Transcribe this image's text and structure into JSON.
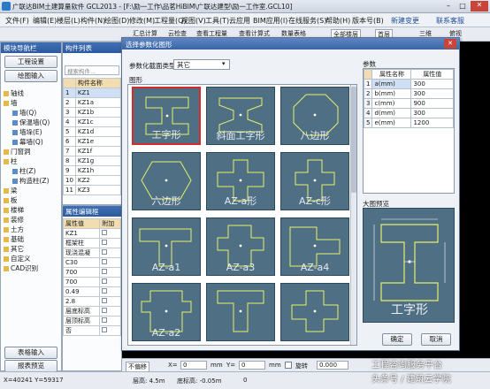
{
  "window": {
    "title": "广联达BIM土建算量软件 GCL2013 - [F:\\励一工作\\品茗HiBIM\\广联达建型\\励一工作室.GCL10]"
  },
  "menu": [
    "文件(F)",
    "编辑(E)",
    "楼层(L)",
    "构件(N)",
    "绘图(D)",
    "修改(M)",
    "工程量(Q)",
    "视图(V)",
    "工具(T)",
    "云应用",
    "BIM应用(I)",
    "在线服务(S)",
    "帮助(H)",
    "版本号(B)",
    "新建变更",
    "联系客服"
  ],
  "toolbar": {
    "items": [
      "汇总计算",
      "云检查",
      "查看工程量",
      "查看计算式",
      "数量表格",
      "全部楼层",
      "首层",
      "三维",
      "俯视"
    ]
  },
  "nav": {
    "title": "模块导航栏",
    "buttons": [
      "工程设置",
      "绘图输入"
    ],
    "tree": [
      {
        "label": "轴线",
        "indent": 0
      },
      {
        "label": "墙",
        "indent": 0
      },
      {
        "label": "墙(Q)",
        "indent": 1
      },
      {
        "label": "保温墙(Q)",
        "indent": 1
      },
      {
        "label": "墙垛(E)",
        "indent": 1
      },
      {
        "label": "幕墙(Q)",
        "indent": 1
      },
      {
        "label": "门窗洞",
        "indent": 0
      },
      {
        "label": "柱",
        "indent": 0
      },
      {
        "label": "柱(Z)",
        "indent": 1
      },
      {
        "label": "构造柱(Z)",
        "indent": 1
      },
      {
        "label": "梁",
        "indent": 0
      },
      {
        "label": "板",
        "indent": 0
      },
      {
        "label": "楼梯",
        "indent": 0
      },
      {
        "label": "装修",
        "indent": 0
      },
      {
        "label": "土方",
        "indent": 0
      },
      {
        "label": "基础",
        "indent": 0
      },
      {
        "label": "其它",
        "indent": 0
      },
      {
        "label": "自定义",
        "indent": 0
      },
      {
        "label": "CAD识别",
        "indent": 0
      }
    ],
    "bottom_buttons": [
      "表格输入",
      "报表预览"
    ]
  },
  "component_list": {
    "title": "构件列表",
    "search_placeholder": "搜索构件...",
    "header": "构件名称",
    "rows": [
      [
        "1",
        "KZ1"
      ],
      [
        "2",
        "KZ1a"
      ],
      [
        "3",
        "KZ1b"
      ],
      [
        "4",
        "KZ1c"
      ],
      [
        "5",
        "KZ1d"
      ],
      [
        "6",
        "KZ1e"
      ],
      [
        "7",
        "KZ1f"
      ],
      [
        "8",
        "KZ1g"
      ],
      [
        "9",
        "KZ1h"
      ],
      [
        "10",
        "KZ2"
      ],
      [
        "11",
        "KZ3"
      ]
    ]
  },
  "attr_editor": {
    "title": "属性编辑框",
    "headers": [
      "属性值",
      "附加"
    ],
    "values": [
      "KZ1",
      "框架柱",
      "现浇混凝",
      "C30",
      "700",
      "700",
      "0.49",
      "2.8",
      "层底标高",
      "层顶标高",
      "否"
    ]
  },
  "dialog": {
    "title": "选择参数化图形",
    "type_label": "参数化截面类型",
    "type_value": "其它",
    "section_shapes": "图形",
    "thumbs": [
      "工字形",
      "斜面工字形",
      "八边形",
      "六边形",
      "AZ-a形",
      "AZ-c形",
      "AZ-a1",
      "AZ-a3",
      "AZ-a4",
      "AZ-a2",
      "",
      ""
    ],
    "params_title": "参数",
    "params_headers": [
      "属性名称",
      "属性值"
    ],
    "params": [
      {
        "no": "1",
        "name": "a(mm)",
        "value": "300"
      },
      {
        "no": "2",
        "name": "b(mm)",
        "value": "300"
      },
      {
        "no": "3",
        "name": "c(mm)",
        "value": "900"
      },
      {
        "no": "4",
        "name": "d(mm)",
        "value": "300"
      },
      {
        "no": "5",
        "name": "e(mm)",
        "value": "1200"
      }
    ],
    "preview_title": "大图预览",
    "preview_label": "工字形",
    "ok": "确定",
    "cancel": "取消"
  },
  "drawbar": {
    "items": [
      "不偏移",
      "X=",
      "0",
      "mm",
      "Y=",
      "0",
      "mm",
      "旋转",
      "0.000"
    ]
  },
  "status": {
    "coords": "X=40241 Y=59317",
    "floor_height": "层高: 4.5m",
    "bottom_elev": "底标高: -0.05m",
    "num": "0"
  },
  "watermark": "头条号 / 建筑云学院",
  "watermark_brand": "工程咨询服务平台"
}
